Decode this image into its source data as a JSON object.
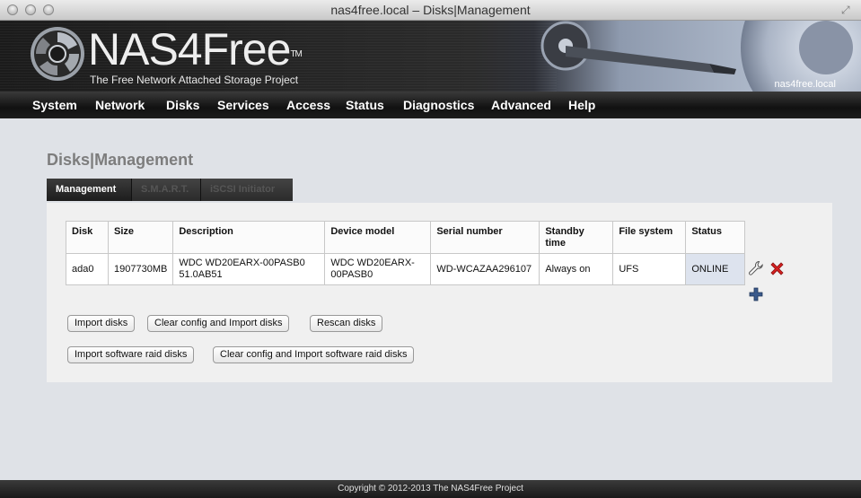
{
  "window": {
    "title": "nas4free.local – Disks|Management"
  },
  "banner": {
    "logo_text": "NAS4Free",
    "trademark": "TM",
    "tagline": "The Free Network Attached Storage Project",
    "hostname": "nas4free.local"
  },
  "menu": [
    "System",
    "Network",
    "Disks",
    "Services",
    "Access",
    "Status",
    "Diagnostics",
    "Advanced",
    "Help"
  ],
  "page": {
    "title": "Disks|Management",
    "tabs": [
      "Management",
      "S.M.A.R.T.",
      "iSCSI Initiator"
    ],
    "active_tab": "Management"
  },
  "table": {
    "headers": [
      "Disk",
      "Size",
      "Description",
      "Device model",
      "Serial number",
      "Standby time",
      "File system",
      "Status"
    ],
    "rows": [
      {
        "disk": "ada0",
        "size": "1907730MB",
        "description": "WDC WD20EARX-00PASB0 51.0AB51",
        "device_model": "WDC WD20EARX-00PASB0",
        "serial": "WD-WCAZAA296107",
        "standby": "Always on",
        "filesystem": "UFS",
        "status": "ONLINE"
      }
    ]
  },
  "row_actions": {
    "edit_icon": "wrench-icon",
    "delete_icon": "delete-x-icon",
    "add_icon": "plus-icon"
  },
  "buttons": {
    "import_disks": "Import disks",
    "clear_import": "Clear config and Import disks",
    "rescan": "Rescan disks",
    "import_raid": "Import software raid disks",
    "clear_import_raid": "Clear config and Import software raid disks"
  },
  "footer": {
    "copyright": "Copyright © 2012-2013 The NAS4Free Project"
  },
  "colors": {
    "delete": "#d42020",
    "add": "#2f4c78",
    "status_cell": "#dde3ee",
    "title_text": "#7d7d7d"
  }
}
